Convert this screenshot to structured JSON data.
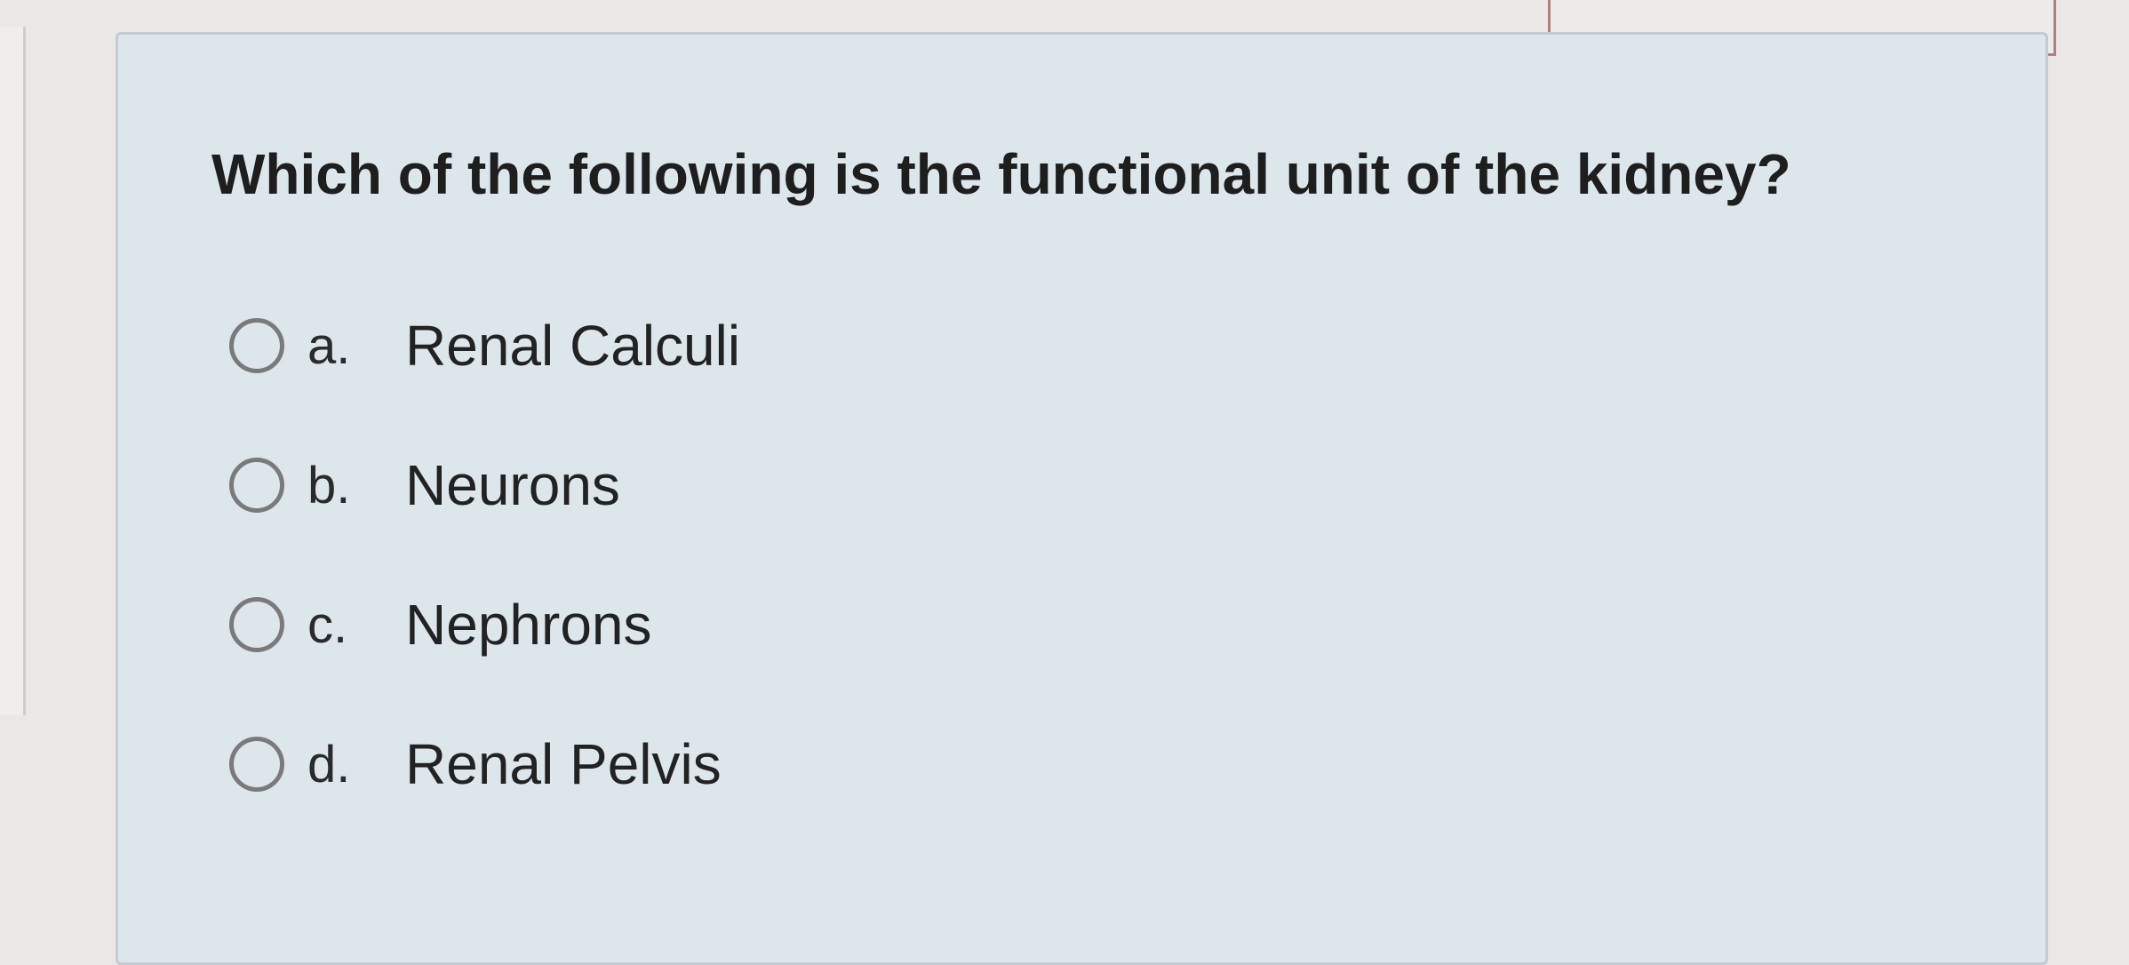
{
  "question": {
    "text": "Which of the following is the functional unit of the kidney?"
  },
  "options": [
    {
      "letter": "a.",
      "text": "Renal Calculi"
    },
    {
      "letter": "b.",
      "text": "Neurons"
    },
    {
      "letter": "c.",
      "text": "Nephrons"
    },
    {
      "letter": "d.",
      "text": "Renal Pelvis"
    }
  ]
}
